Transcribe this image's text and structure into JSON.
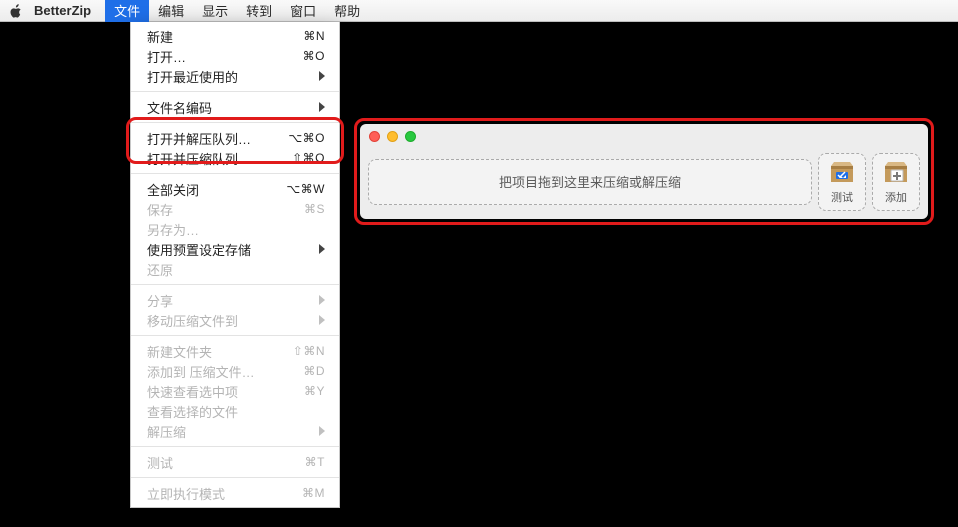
{
  "menubar": {
    "app_name": "BetterZip",
    "items": [
      "文件",
      "编辑",
      "显示",
      "转到",
      "窗口",
      "帮助"
    ],
    "active_index": 0
  },
  "dropdown": {
    "groups": [
      [
        {
          "label": "新建",
          "shortcut": "⌘N"
        },
        {
          "label": "打开…",
          "shortcut": "⌘O"
        },
        {
          "label": "打开最近使用的",
          "submenu": true
        }
      ],
      [
        {
          "label": "文件名编码",
          "submenu": true
        }
      ],
      [
        {
          "label": "打开并解压队列…",
          "shortcut": "⌥⌘O"
        },
        {
          "label": "打开并压缩队列…",
          "shortcut": "⇧⌘O"
        }
      ],
      [
        {
          "label": "全部关闭",
          "shortcut": "⌥⌘W"
        },
        {
          "label": "保存",
          "shortcut": "⌘S",
          "disabled": true
        },
        {
          "label": "另存为…",
          "disabled": true
        },
        {
          "label": "使用预置设定存储",
          "submenu": true
        },
        {
          "label": "还原",
          "disabled": true
        }
      ],
      [
        {
          "label": "分享",
          "submenu": true,
          "disabled": true
        },
        {
          "label": "移动压缩文件到",
          "submenu": true,
          "disabled": true
        }
      ],
      [
        {
          "label": "新建文件夹",
          "shortcut": "⇧⌘N",
          "disabled": true
        },
        {
          "label": "添加到 压缩文件…",
          "shortcut": "⌘D",
          "disabled": true
        },
        {
          "label": "快速查看选中项",
          "shortcut": "⌘Y",
          "disabled": true
        },
        {
          "label": "查看选择的文件",
          "disabled": true
        },
        {
          "label": "解压缩",
          "submenu": true,
          "disabled": true
        }
      ],
      [
        {
          "label": "测试",
          "shortcut": "⌘T",
          "disabled": true
        }
      ],
      [
        {
          "label": "立即执行模式",
          "shortcut": "⌘M",
          "disabled": true
        }
      ]
    ]
  },
  "window": {
    "dropzone_text": "把项目拖到这里来压缩或解压缩",
    "test_label": "测试",
    "add_label": "添加"
  }
}
